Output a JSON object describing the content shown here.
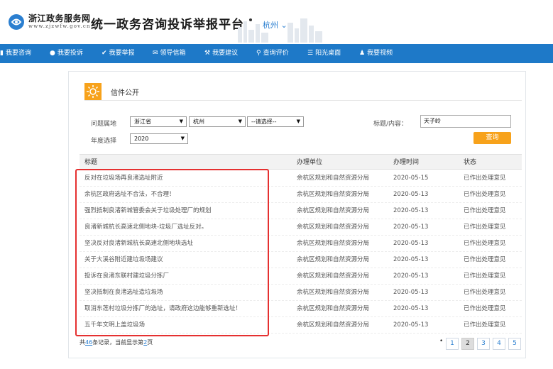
{
  "header": {
    "site_name": "浙江政务服务网",
    "site_url": "www.zjzwfw.gov.cn",
    "platform_title": "统一政务咨询投诉举报平台",
    "city": "杭州"
  },
  "nav": [
    {
      "label": "我要咨询",
      "icon": "file-icon"
    },
    {
      "label": "我要投诉",
      "icon": "user-icon"
    },
    {
      "label": "我要举报",
      "icon": "check-icon"
    },
    {
      "label": "领导信箱",
      "icon": "mail-icon"
    },
    {
      "label": "我要建议",
      "icon": "wand-icon"
    },
    {
      "label": "查询评价",
      "icon": "search-icon"
    },
    {
      "label": "阳光桌面",
      "icon": "list-icon"
    },
    {
      "label": "我要视频",
      "icon": "people-icon"
    }
  ],
  "section": {
    "title": "信件公开"
  },
  "filters": {
    "region_label": "问题属地",
    "province": "浙江省",
    "city": "杭州",
    "district": "--请选择--",
    "year_label": "年度选择",
    "year": "2020",
    "keyword_label": "标题/内容：",
    "keyword_value": "天子岭",
    "query_button": "查询"
  },
  "table": {
    "headers": [
      "标题",
      "办理单位",
      "办理时间",
      "状态"
    ],
    "rows": [
      {
        "title": "反对在垃圾场再良渚选址附近",
        "dept": "余杭区规划和自然资源分局",
        "time": "2020-05-15",
        "status": "已作出处理意见"
      },
      {
        "title": "余杭区政府选址不合法，不合理！",
        "dept": "余杭区规划和自然资源分局",
        "time": "2020-05-13",
        "status": "已作出处理意见"
      },
      {
        "title": "强烈抵制良渚新城管委会关于垃圾处理厂的规划",
        "dept": "余杭区规划和自然资源分局",
        "time": "2020-05-13",
        "status": "已作出处理意见"
      },
      {
        "title": "良渚新城杭长高速北侧地块-垃圾厂选址反对。",
        "dept": "余杭区规划和自然资源分局",
        "time": "2020-05-13",
        "status": "已作出处理意见"
      },
      {
        "title": "坚决反对良渚新城杭长高速北侧地块选址",
        "dept": "余杭区规划和自然资源分局",
        "time": "2020-05-13",
        "status": "已作出处理意见"
      },
      {
        "title": "关于大溪谷附近建垃圾场建议",
        "dept": "余杭区规划和自然资源分局",
        "time": "2020-05-13",
        "status": "已作出处理意见"
      },
      {
        "title": "投诉在良渚东联村建垃圾分拣厂",
        "dept": "余杭区规划和自然资源分局",
        "time": "2020-05-13",
        "status": "已作出处理意见"
      },
      {
        "title": "坚决抵制在良渚选址造垃圾场",
        "dept": "余杭区规划和自然资源分局",
        "time": "2020-05-13",
        "status": "已作出处理意见"
      },
      {
        "title": "取消东莲村垃圾分拣厂的选址，请政府这边能够重新选址！",
        "dept": "余杭区规划和自然资源分局",
        "time": "2020-05-13",
        "status": "已作出处理意见"
      },
      {
        "title": "五千年文明上盖垃圾场",
        "dept": "余杭区规划和自然资源分局",
        "time": "2020-05-13",
        "status": "已作出处理意见"
      }
    ]
  },
  "pagination": {
    "total_prefix": "共",
    "total_count": "46",
    "total_mid": "条记录，当前显示第",
    "current_page": "2",
    "total_suffix": "页",
    "dot": "•",
    "pages": [
      "1",
      "2",
      "3",
      "4",
      "5"
    ],
    "active": "2"
  },
  "colors": {
    "brand_blue": "#1e79c8",
    "accent_orange": "#f7a21b",
    "highlight_red": "#e53030"
  }
}
